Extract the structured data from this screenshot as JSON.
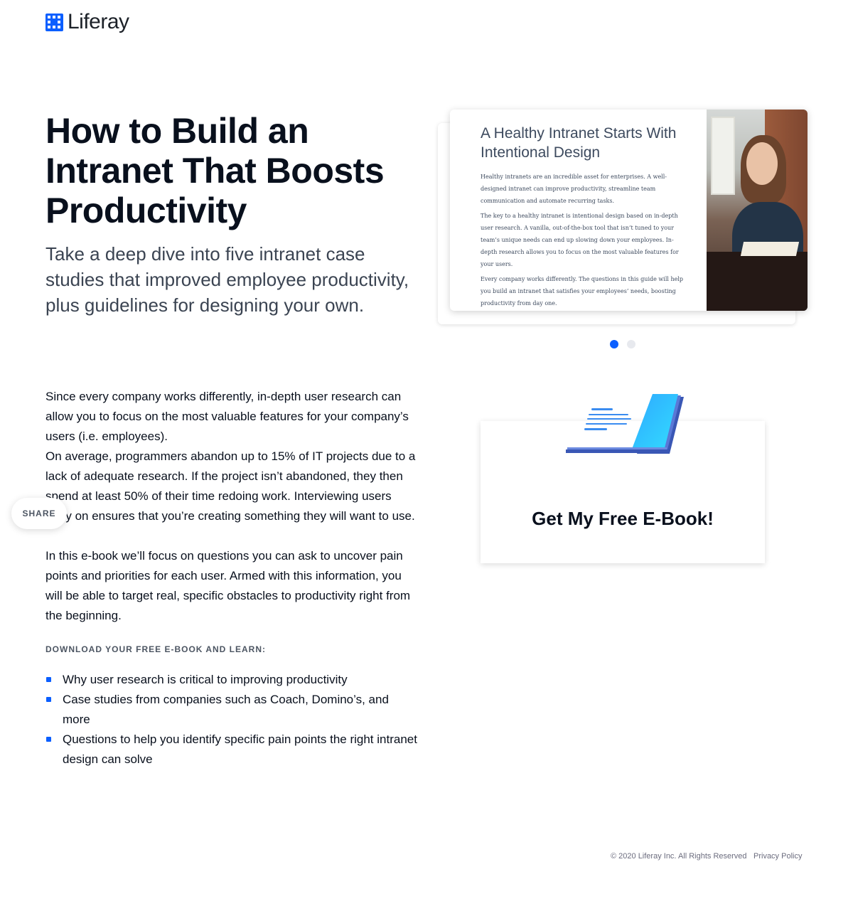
{
  "brand": {
    "name": "Liferay",
    "accent": "#0b5fff"
  },
  "hero": {
    "title": "How to Build an Intranet That Boosts Productivity",
    "subtitle": "Take a deep dive into five intranet case studies that improved employee productivity, plus guidelines for designing your own."
  },
  "body": {
    "p1": "Since every company works differently, in-depth user research can allow you to focus on the most valuable features for your company’s users (i.e. employees).",
    "p2": "On average, programmers abandon up to 15% of IT projects due to a lack of adequate research. If the project isn’t abandoned, they then spend at least 50% of their time redoing work. Interviewing users early on ensures that you’re creating something they will want to use.",
    "p3": "In this e-book we’ll focus on questions you can ask to uncover pain points and priorities for each user. Armed with this information, you will be able to target real, specific obstacles to productivity right from the beginning."
  },
  "learn": {
    "heading": "DOWNLOAD YOUR FREE E-BOOK AND LEARN:",
    "items": [
      "Why user research is critical to improving productivity",
      "Case studies from companies such as Coach, Domino’s, and more",
      "Questions to help you identify specific pain points the right intranet design can solve"
    ]
  },
  "share": {
    "label": "SHARE"
  },
  "carousel": {
    "slide_title": "A Healthy Intranet Starts With Intentional Design",
    "paragraphs": [
      "Healthy intranets are an incredible asset for enterprises. A well-designed intranet can improve productivity, streamline team communication and automate recurring tasks.",
      "The key to a healthy intranet is intentional design based on in-depth user research. A vanilla, out-of-the-box tool that isn’t tuned to your team’s unique needs can end up slowing down your employees. In-depth research allows you to focus on the most valuable features for your users.",
      "Every company works differently. The questions in this guide will help you build an intranet that satisfies your employees’ needs, boosting productivity from day one."
    ],
    "active_slide": 1,
    "slide_count": 2
  },
  "cta": {
    "label": "Get My Free E-Book!"
  },
  "footer": {
    "copyright": "© 2020 Liferay Inc. All Rights Reserved",
    "privacy": "Privacy Policy"
  }
}
